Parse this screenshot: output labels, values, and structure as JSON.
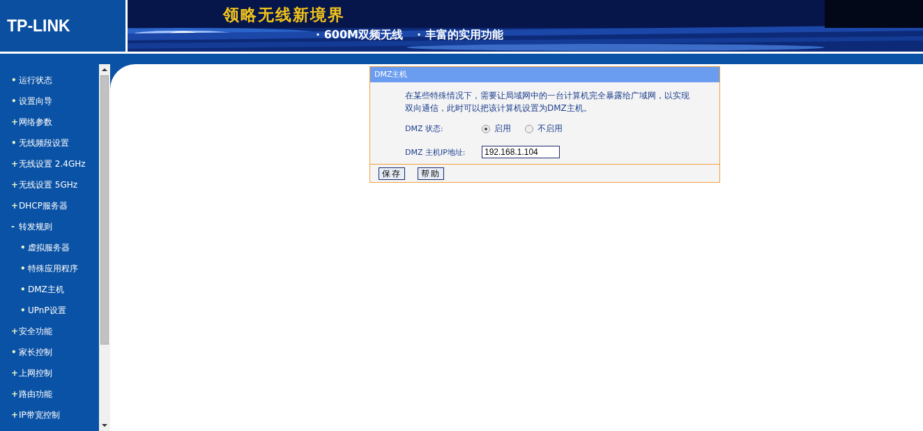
{
  "header": {
    "logo": "TP-LINK",
    "slogan": "领略无线新境界",
    "features": [
      "· 600M双频无线",
      "· 丰富的实用功能"
    ]
  },
  "sidebar": {
    "items": [
      {
        "marker": "•",
        "label": "运行状态",
        "selected": false
      },
      {
        "marker": "•",
        "label": "设置向导",
        "selected": false
      },
      {
        "marker": "+",
        "label": "网络参数",
        "selected": false
      },
      {
        "marker": "•",
        "label": "无线频段设置",
        "selected": false
      },
      {
        "marker": "+",
        "label": "无线设置 2.4GHz",
        "selected": false
      },
      {
        "marker": "+",
        "label": "无线设置 5GHz",
        "selected": false
      },
      {
        "marker": "+",
        "label": "DHCP服务器",
        "selected": false
      },
      {
        "marker": "-",
        "label": "转发规则",
        "selected": false,
        "children": [
          {
            "marker": "•",
            "label": "虚拟服务器",
            "selected": false
          },
          {
            "marker": "•",
            "label": "特殊应用程序",
            "selected": false
          },
          {
            "marker": "•",
            "label": "DMZ主机",
            "selected": false
          },
          {
            "marker": "•",
            "label": "UPnP设置",
            "selected": false
          }
        ]
      },
      {
        "marker": "+",
        "label": "安全功能",
        "selected": false
      },
      {
        "marker": "•",
        "label": "家长控制",
        "selected": false
      },
      {
        "marker": "+",
        "label": "上网控制",
        "selected": false
      },
      {
        "marker": "+",
        "label": "路由功能",
        "selected": false
      },
      {
        "marker": "+",
        "label": "IP带宽控制",
        "selected": false
      }
    ]
  },
  "panel": {
    "title": "DMZ主机",
    "description": "在某些特殊情况下，需要让局域网中的一台计算机完全暴露给广域网，以实现双向通信，此时可以把该计算机设置为DMZ主机。",
    "status": {
      "label": "DMZ 状态:",
      "options": [
        {
          "label": "启用",
          "selected": true
        },
        {
          "label": "不启用",
          "selected": false
        }
      ]
    },
    "host_ip": {
      "label": "DMZ 主机IP地址:",
      "value": "192.168.1.104"
    },
    "buttons": [
      "保存",
      "帮助"
    ]
  }
}
